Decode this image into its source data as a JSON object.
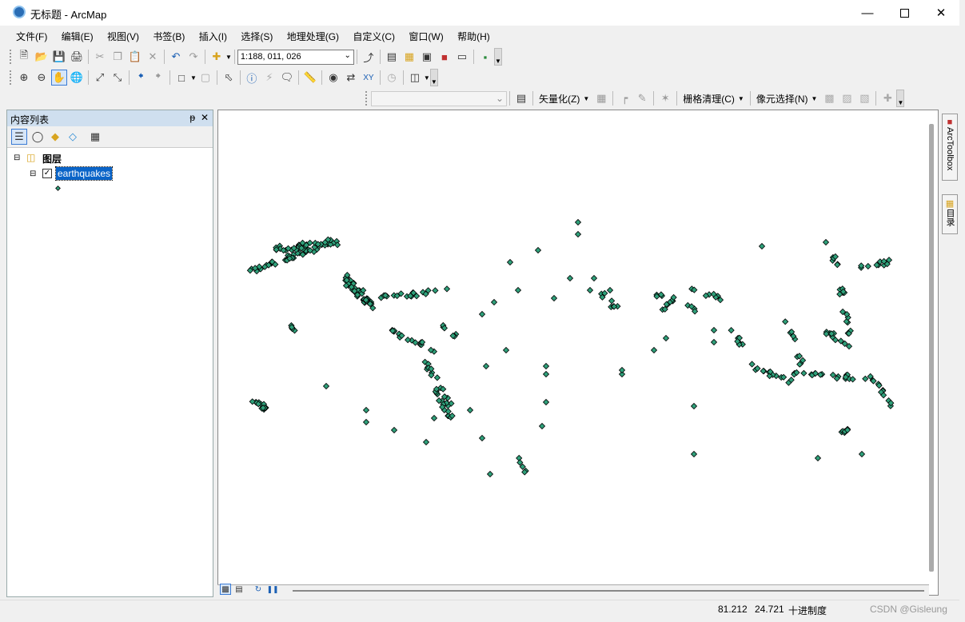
{
  "window": {
    "title": "无标题 - ArcMap",
    "min_icon": "minimize-icon",
    "max_icon": "maximize-icon",
    "close_icon": "close-icon"
  },
  "menu": [
    "文件(F)",
    "编辑(E)",
    "视图(V)",
    "书签(B)",
    "插入(I)",
    "选择(S)",
    "地理处理(G)",
    "自定义(C)",
    "窗口(W)",
    "帮助(H)"
  ],
  "standard_toolbar": {
    "scale": "1:188, 011, 026"
  },
  "georef_toolbar": {
    "vectorize": "矢量化(Z)",
    "raster_cleanup": "栅格清理(C)",
    "cell_select": "像元选择(N)"
  },
  "toc": {
    "title": "内容列表",
    "pin": "ᵽ",
    "close": "✕",
    "group": "图层",
    "layer": "earthquakes"
  },
  "dock": {
    "arctoolbox": "ArcToolbox",
    "catalog": "目录"
  },
  "status": {
    "x": "81.212",
    "y": "24.721",
    "units": "十进制度",
    "watermark": "CSDN @Gisleung"
  },
  "colors": {
    "point_fill": "#2fa07a",
    "selection": "#0a64c8",
    "toc_header": "#cfdfef"
  }
}
